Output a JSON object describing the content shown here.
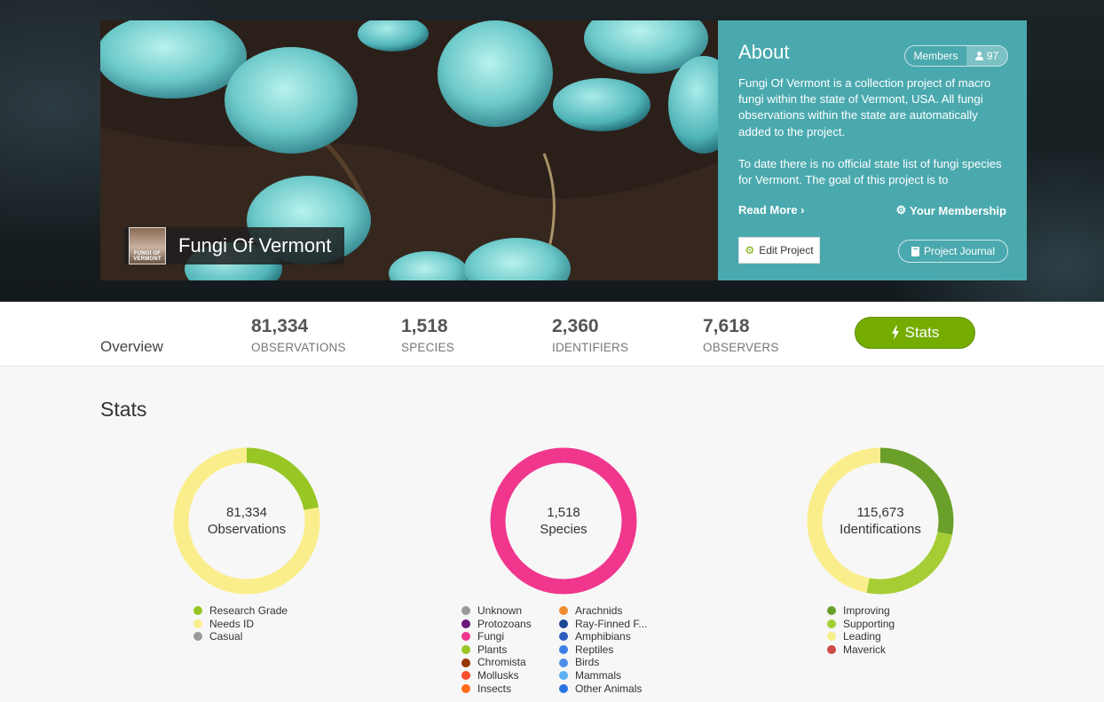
{
  "project": {
    "name": "Fungi Of Vermont",
    "logo_text": "FUNGI OF VERMONT"
  },
  "about": {
    "title": "About",
    "members_label": "Members",
    "members_count": "97",
    "paragraphs": [
      "Fungi Of Vermont is a collection project of macro fungi within the state of Vermont, USA. All fungi observations within the state are automatically added to the project.",
      "To date there is no official state list of fungi species for Vermont. The goal of this project is to"
    ],
    "read_more": "Read More ›",
    "your_membership": "Your Membership",
    "edit_project": "Edit Project",
    "project_journal": "Project Journal"
  },
  "overview": {
    "label": "Overview",
    "stats": [
      {
        "value": "81,334",
        "label": "OBSERVATIONS"
      },
      {
        "value": "1,518",
        "label": "SPECIES"
      },
      {
        "value": "2,360",
        "label": "IDENTIFIERS"
      },
      {
        "value": "7,618",
        "label": "OBSERVERS"
      }
    ],
    "stats_button": "Stats"
  },
  "stats": {
    "title": "Stats",
    "donuts": [
      {
        "value": "81,334",
        "label": "Observations",
        "segments": [
          {
            "name": "Research Grade",
            "fraction": 0.22,
            "color": "#97c625"
          },
          {
            "name": "Needs ID",
            "fraction": 0.78,
            "color": "#faee8c"
          },
          {
            "name": "Casual",
            "fraction": 0.0,
            "color": "#999999"
          }
        ]
      },
      {
        "value": "1,518",
        "label": "Species",
        "segments": [
          {
            "name": "Fungi",
            "fraction": 1.0,
            "color": "#f0368d"
          }
        ],
        "legend": [
          {
            "name": "Unknown",
            "color": "#999999"
          },
          {
            "name": "Protozoans",
            "color": "#691776"
          },
          {
            "name": "Fungi",
            "color": "#f0368d"
          },
          {
            "name": "Plants",
            "color": "#97c625"
          },
          {
            "name": "Chromista",
            "color": "#993300"
          },
          {
            "name": "Mollusks",
            "color": "#ff4d2e"
          },
          {
            "name": "Insects",
            "color": "#ff6a1a"
          },
          {
            "name": "Arachnids",
            "color": "#f08c2e"
          },
          {
            "name": "Ray-Finned F...",
            "color": "#1e4896"
          },
          {
            "name": "Amphibians",
            "color": "#2c5cbf"
          },
          {
            "name": "Reptiles",
            "color": "#3c7de8"
          },
          {
            "name": "Birds",
            "color": "#4d8ee9"
          },
          {
            "name": "Mammals",
            "color": "#5ab2f2"
          },
          {
            "name": "Other Animals",
            "color": "#2a74e0"
          }
        ]
      },
      {
        "value": "115,673",
        "label": "Identifications",
        "segments": [
          {
            "name": "Improving",
            "fraction": 0.28,
            "color": "#6a9f2a"
          },
          {
            "name": "Supporting",
            "fraction": 0.25,
            "color": "#a6cd34"
          },
          {
            "name": "Leading",
            "fraction": 0.47,
            "color": "#faee8c"
          },
          {
            "name": "Maverick",
            "fraction": 0.0,
            "color": "#d04b46"
          }
        ]
      }
    ]
  }
}
